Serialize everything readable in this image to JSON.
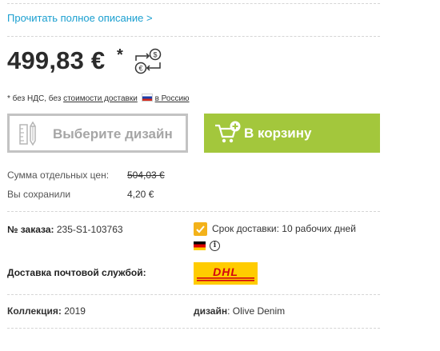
{
  "description_link": "Прочитать полное описание >",
  "price": {
    "amount": "499,83 €",
    "marker": "*"
  },
  "vat_note": {
    "prefix": "* без НДС, без",
    "shipping_cost_link": "стоимости доставки",
    "country_link": "в Россию",
    "country_flag": "flag-russia"
  },
  "buttons": {
    "design_label": "Выберите дизайн",
    "cart_label": "В корзину"
  },
  "summary": {
    "sum_label": "Сумма отдельных цен:",
    "sum_value": "504,03 €",
    "saved_label": "Вы сохранили",
    "saved_value": "4,20 €"
  },
  "order": {
    "label": "№ заказа:",
    "value": "235-S1-103763"
  },
  "delivery": {
    "time_label": "Срок доставки: 10 рабочих дней",
    "origin_flag": "flag-germany",
    "ship_label": "Доставка почтовой службой:",
    "carrier_logo": "DHL"
  },
  "details": {
    "collection_label": "Коллекция:",
    "collection_value": "2019",
    "design_label": "дизайн",
    "design_value": "Olive Denim"
  },
  "colors": {
    "link": "#1a9fd0",
    "cart_button": "#a3c73c",
    "check": "#f3b21a",
    "dhl_yellow": "#ffcc00",
    "dhl_red": "#d40511"
  }
}
